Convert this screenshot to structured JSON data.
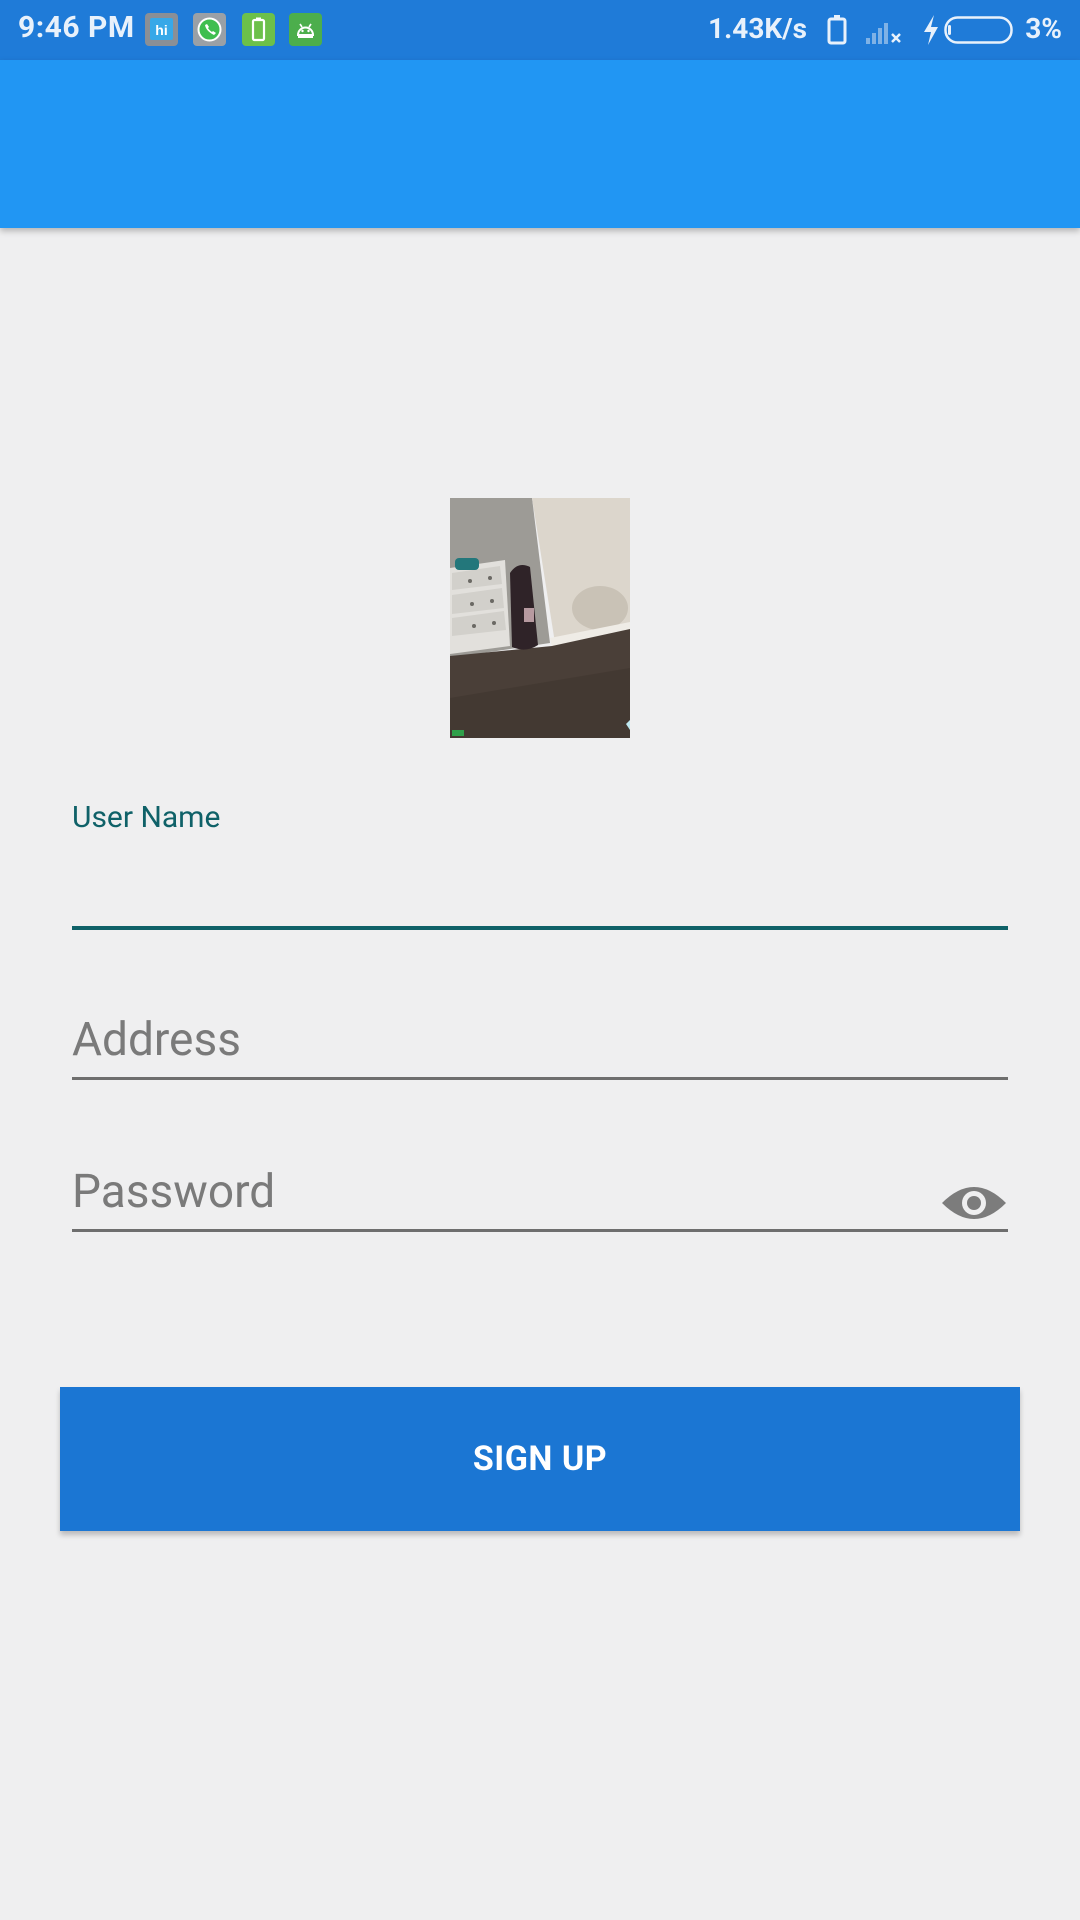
{
  "status_bar": {
    "time": "9:46 PM",
    "net_speed": "1.43K/s",
    "battery_percent": "3%",
    "notification_icons": [
      "hi-app-icon",
      "whatsapp-icon",
      "battery-saver-icon",
      "android-icon"
    ],
    "status_icons": [
      "vibrate-icon",
      "signal-no-service-icon",
      "charging-icon",
      "battery-icon"
    ],
    "background_color": "#1f7bd8"
  },
  "app_bar": {
    "color": "#2196f3"
  },
  "profile": {
    "image_icon": "profile-photo"
  },
  "form": {
    "username_label": "User Name",
    "username_value": "",
    "address_placeholder": "Address",
    "password_placeholder": "Password",
    "password_toggle_icon": "eye-icon",
    "accent_color": "#0f6168"
  },
  "signup_button": {
    "label": "SIGN UP",
    "color": "#1b76d3"
  }
}
